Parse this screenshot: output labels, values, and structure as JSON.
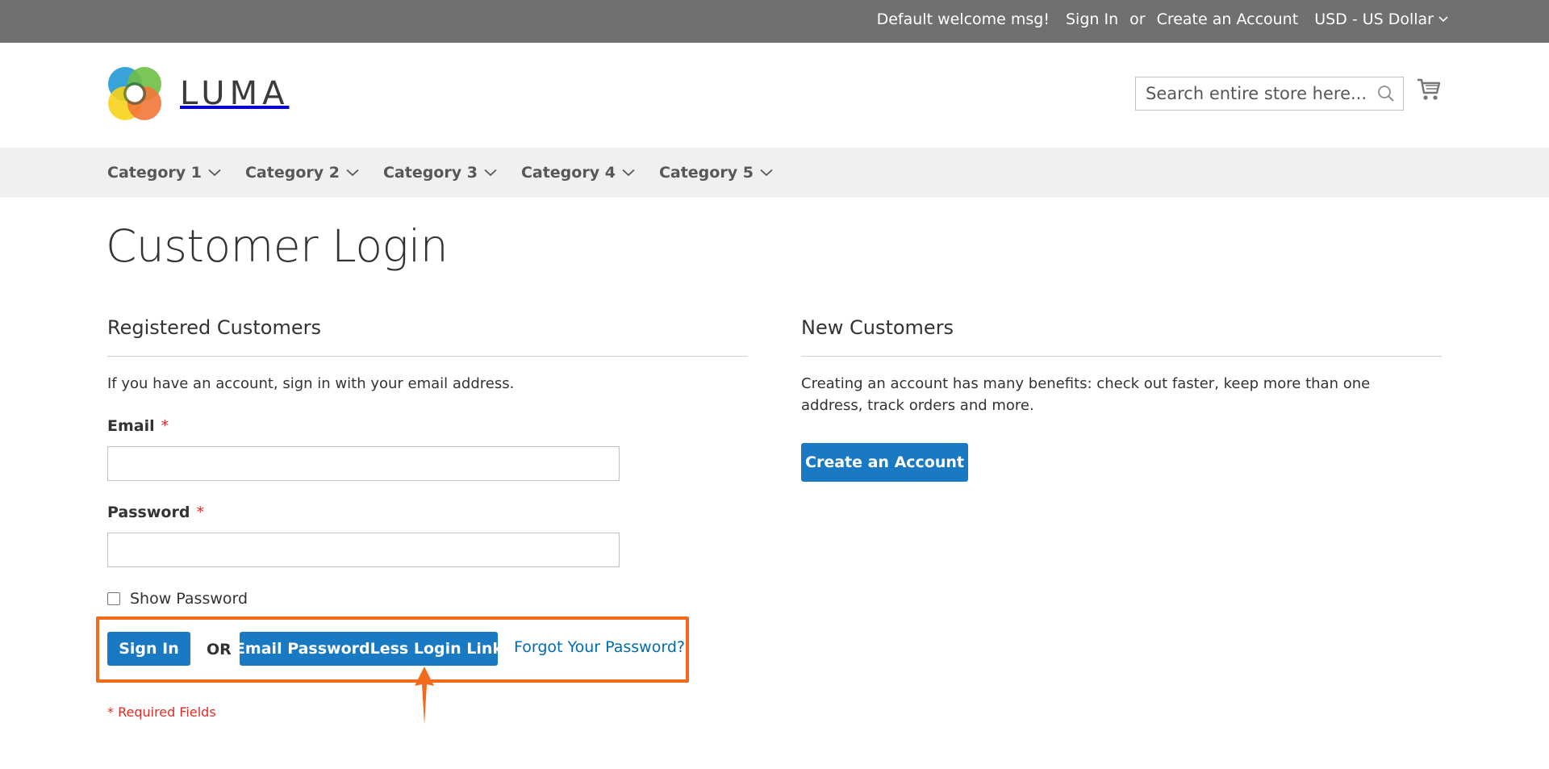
{
  "top_bar": {
    "welcome": "Default welcome msg!",
    "sign_in": "Sign In",
    "or": "or",
    "create_account": "Create an Account",
    "currency": "USD - US Dollar"
  },
  "header": {
    "logo_text": "LUMA",
    "search_placeholder": "Search entire store here...",
    "search_icon": "search-icon",
    "cart_icon": "shopping-cart-icon"
  },
  "nav": {
    "items": [
      {
        "label": "Category 1"
      },
      {
        "label": "Category 2"
      },
      {
        "label": "Category 3"
      },
      {
        "label": "Category 4"
      },
      {
        "label": "Category 5"
      }
    ]
  },
  "page": {
    "title": "Customer Login"
  },
  "registered": {
    "title": "Registered Customers",
    "intro": "If you have an account, sign in with your email address.",
    "email_label": "Email",
    "password_label": "Password",
    "required_mark": "*",
    "show_password": "Show Password",
    "sign_in_button": "Sign In",
    "or": "OR",
    "passwordless_button": "Email PasswordLess Login Link",
    "forgot_link": "Forgot Your Password?",
    "required_note": "* Required Fields"
  },
  "new_customers": {
    "title": "New Customers",
    "text": "Creating an account has many benefits: check out faster, keep more than one address, track orders and more.",
    "create_button": "Create an Account"
  },
  "colors": {
    "top_bar": "#6e716e",
    "primary_button": "#1979c3",
    "link": "#006bb4",
    "required": "#e02b27",
    "annotation": "#f26a1b"
  }
}
